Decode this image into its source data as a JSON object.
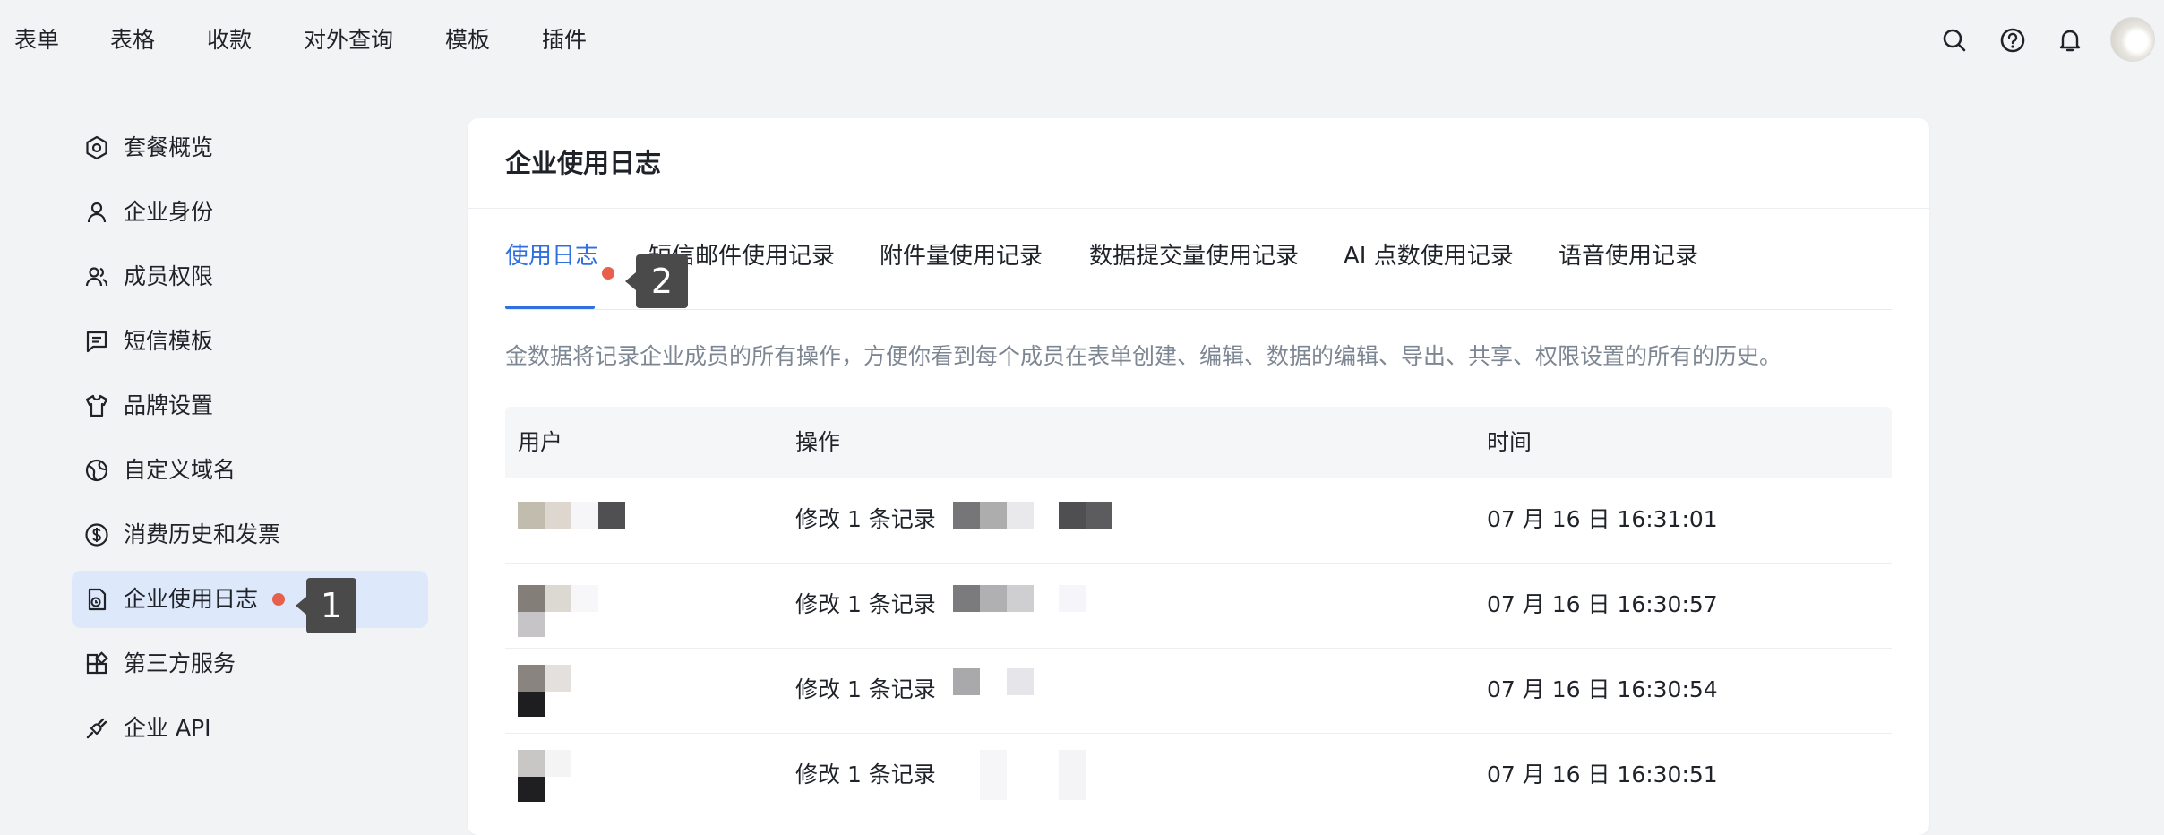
{
  "topnav": {
    "items": [
      "表单",
      "表格",
      "收款",
      "对外查询",
      "模板",
      "插件"
    ]
  },
  "topicons": [
    "search-icon",
    "help-icon",
    "bell-icon",
    "avatar"
  ],
  "sidebar": {
    "items": [
      {
        "label": "套餐概览",
        "icon": "hexagon-icon"
      },
      {
        "label": "企业身份",
        "icon": "user-icon"
      },
      {
        "label": "成员权限",
        "icon": "users-icon"
      },
      {
        "label": "短信模板",
        "icon": "message-icon"
      },
      {
        "label": "品牌设置",
        "icon": "shirt-icon"
      },
      {
        "label": "自定义域名",
        "icon": "globe-icon"
      },
      {
        "label": "消费历史和发票",
        "icon": "dollar-icon"
      },
      {
        "label": "企业使用日志",
        "icon": "log-icon",
        "active": true
      },
      {
        "label": "第三方服务",
        "icon": "apps-icon"
      },
      {
        "label": "企业 API",
        "icon": "plug-icon"
      }
    ]
  },
  "callouts": {
    "one": "1",
    "two": "2"
  },
  "card": {
    "title": "企业使用日志",
    "tabs": [
      "使用日志",
      "短信邮件使用记录",
      "附件量使用记录",
      "数据提交量使用记录",
      "AI 点数使用记录",
      "语音使用记录"
    ],
    "description": "金数据将记录企业成员的所有操作，方便你看到每个成员在表单创建、编辑、数据的编辑、导出、共享、权限设置的所有的历史。",
    "table": {
      "headers": [
        "用户",
        "操作",
        "时间"
      ],
      "rows": [
        {
          "action": "修改 1 条记录",
          "time": "07 月 16 日 16:31:01"
        },
        {
          "action": "修改 1 条记录",
          "time": "07 月 16 日 16:30:57"
        },
        {
          "action": "修改 1 条记录",
          "time": "07 月 16 日 16:30:54"
        },
        {
          "action": "修改 1 条记录",
          "time": "07 月 16 日 16:30:51"
        }
      ]
    }
  },
  "colors": {
    "accent": "#2f6fe0",
    "badge": "#e8604c",
    "active_bg": "#dde8fb"
  }
}
